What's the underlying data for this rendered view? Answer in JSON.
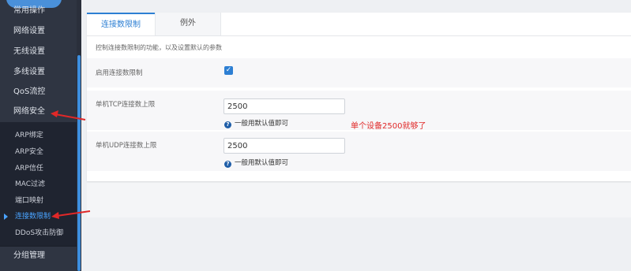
{
  "sidebar": {
    "brand": "",
    "items": [
      {
        "label": "常用操作"
      },
      {
        "label": "网络设置"
      },
      {
        "label": "无线设置"
      },
      {
        "label": "多线设置"
      },
      {
        "label": "QoS流控"
      },
      {
        "label": "网络安全"
      }
    ],
    "submenu": [
      {
        "label": "ARP绑定"
      },
      {
        "label": "ARP安全"
      },
      {
        "label": "ARP信任"
      },
      {
        "label": "MAC过滤"
      },
      {
        "label": "端口映射"
      },
      {
        "label": "连接数限制"
      },
      {
        "label": "DDoS攻击防御"
      }
    ],
    "bottom_item": "分组管理"
  },
  "tabs": [
    {
      "label": "连接数限制",
      "active": true
    },
    {
      "label": "例外",
      "active": false
    }
  ],
  "description": "控制连接数限制的功能，以及设置默认的参数",
  "settings": {
    "enable_label": "启用连接数限制",
    "enable_checked": true,
    "tcp_label": "单机TCP连接数上限",
    "tcp_value": "2500",
    "tcp_hint": "一般用默认值即可",
    "udp_label": "单机UDP连接数上限",
    "udp_value": "2500",
    "udp_hint": "一般用默认值即可"
  },
  "annotation": "单个设备2500就够了",
  "colors": {
    "accent": "#2d7fd3",
    "sidebar_bg": "#2f3542",
    "annotation": "#e02828"
  },
  "icons": {
    "checkbox": "check-icon",
    "hint": "question-circle-icon",
    "arrow": "red-arrow-icon"
  }
}
